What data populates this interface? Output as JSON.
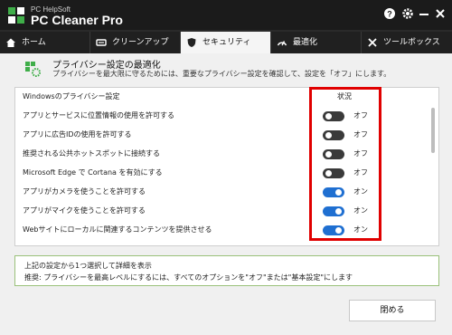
{
  "titlebar": {
    "brand": "PC HelpSoft",
    "product": "PC Cleaner Pro"
  },
  "tabs": [
    {
      "label": "ホーム",
      "icon": "home-icon"
    },
    {
      "label": "クリーンアップ",
      "icon": "clean-icon"
    },
    {
      "label": "セキュリティ",
      "icon": "shield-icon"
    },
    {
      "label": "最適化",
      "icon": "speed-icon"
    },
    {
      "label": "ツールボックス",
      "icon": "tools-icon"
    }
  ],
  "header": {
    "title": "プライバシー設定の最適化",
    "subtitle": "プライバシーを最大限に守るためには、重要なプライバシー設定を確認して、設定を「オフ」にします。"
  },
  "list": {
    "column_header": "Windowsのプライバシー設定",
    "status_header": "状況",
    "rows": [
      {
        "label": "アプリとサービスに位置情報の使用を許可する",
        "state": "オフ",
        "on": false
      },
      {
        "label": "アプリに広告IDの使用を許可する",
        "state": "オフ",
        "on": false
      },
      {
        "label": "推奨される公共ホットスポットに接続する",
        "state": "オフ",
        "on": false
      },
      {
        "label": "Microsoft Edge で Cortana を有効にする",
        "state": "オフ",
        "on": false
      },
      {
        "label": "アプリがカメラを使うことを許可する",
        "state": "オン",
        "on": true
      },
      {
        "label": "アプリがマイクを使うことを許可する",
        "state": "オン",
        "on": true
      },
      {
        "label": "Webサイトにローカルに関連するコンテンツを提供させる",
        "state": "オン",
        "on": true
      }
    ]
  },
  "info": {
    "line1": "上記の設定から1つ選択して詳細を表示",
    "line2": "推奨: プライバシーを最高レベルにするには、すべてのオプションを\"オフ\"または\"基本設定\"にします"
  },
  "buttons": {
    "close": "閉める"
  },
  "colors": {
    "toggle_on": "#1f6fd1",
    "toggle_off": "#3a3a3a",
    "highlight": "#e00000"
  }
}
